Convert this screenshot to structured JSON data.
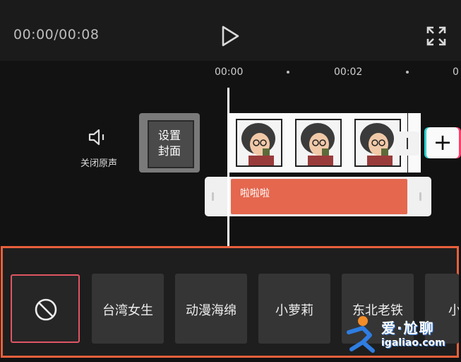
{
  "player": {
    "time": "00:00/00:08",
    "play_icon": "play-icon",
    "fullscreen_icon": "fullscreen-icon"
  },
  "ruler": {
    "ticks": [
      "00:00",
      "00:02",
      "0"
    ]
  },
  "timeline": {
    "mute_label": "关闭原声",
    "mute_icon": "speaker-icon",
    "cover_label": "设置封面",
    "add_icon": "plus-icon",
    "audio_clip_label": "啦啦啦"
  },
  "voice_panel": {
    "none_icon": "forbidden-icon",
    "items": [
      {
        "label": "台湾女生"
      },
      {
        "label": "动漫海绵"
      },
      {
        "label": "小萝莉"
      },
      {
        "label": "东北老铁"
      },
      {
        "label": "小妹"
      }
    ],
    "accent_color": "#e8603c"
  },
  "watermark": {
    "line1": "爱·尬聊",
    "line2": "igaliao.com"
  }
}
